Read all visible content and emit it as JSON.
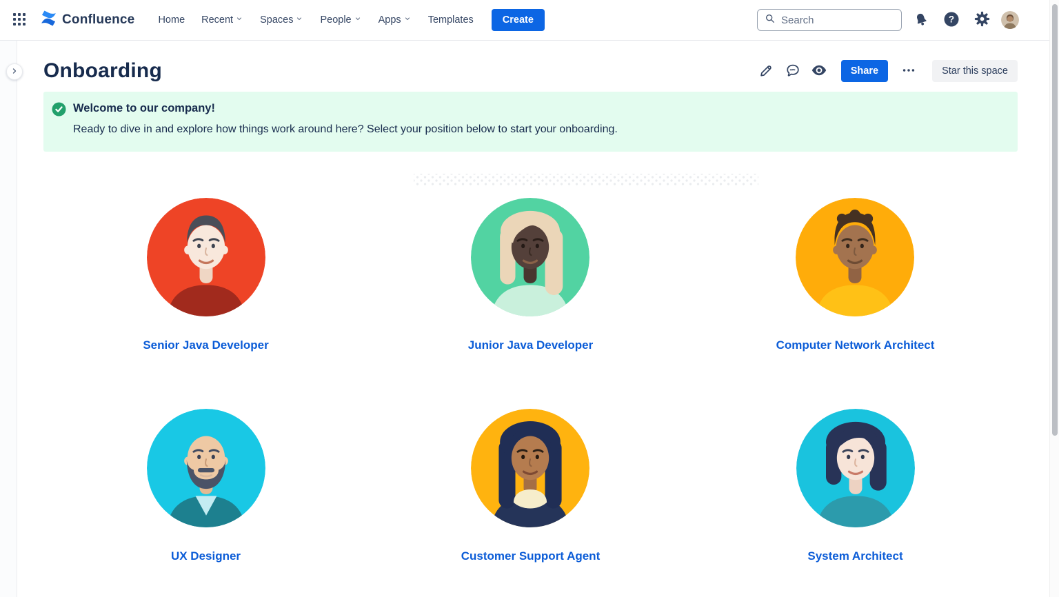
{
  "topbar": {
    "product_name": "Confluence",
    "nav_items": [
      {
        "label": "Home",
        "dropdown": false
      },
      {
        "label": "Recent",
        "dropdown": true
      },
      {
        "label": "Spaces",
        "dropdown": true
      },
      {
        "label": "People",
        "dropdown": true
      },
      {
        "label": "Apps",
        "dropdown": true
      },
      {
        "label": "Templates",
        "dropdown": false
      }
    ],
    "create_button": "Create",
    "search_placeholder": "Search"
  },
  "page_header": {
    "title": "Onboarding",
    "share_button": "Share",
    "star_button": "Star this space"
  },
  "banner": {
    "heading": "Welcome to our company!",
    "message": "Ready to dive in and explore how things work around here? Select your position below to start your onboarding."
  },
  "roles": [
    {
      "label": "Senior Java Developer",
      "avatar": {
        "variant": "buzz",
        "colors": {
          "bg": "#EE4426",
          "skin": "#F8E8DC",
          "skinD": "#EFD6C4",
          "hair": "#4A4E58",
          "shirt": "#A12A1D",
          "brow": "#3E4450",
          "eye": "#3E4450",
          "mouth": "#C4765B",
          "nose": "#D9B59F"
        }
      }
    },
    {
      "label": "Junior Java Developer",
      "avatar": {
        "variant": "long",
        "colors": {
          "bg": "#52D3A2",
          "skin": "#54403A",
          "skinD": "#48362F",
          "hair": "#EBD6B8",
          "shirt": "#C9F0DC",
          "brow": "#2A1E19",
          "eye": "#241A16",
          "mouth": "#8A6248",
          "nose": "#3A2B24"
        }
      }
    },
    {
      "label": "Computer Network Architect",
      "avatar": {
        "variant": "curly",
        "colors": {
          "bg": "#FFAC0A",
          "skin": "#A3734F",
          "skinD": "#916344",
          "hair": "#453122",
          "shirt": "#FFC116",
          "brow": "#3F2D1F",
          "eye": "#32241A",
          "mouth": "#6E4C34",
          "nose": "#7E5A3F"
        }
      }
    },
    {
      "label": "UX Designer",
      "avatar": {
        "variant": "beard",
        "colors": {
          "bg": "#19C8E5",
          "skin": "#EEC9A4",
          "skinD": "#E2BA92",
          "hair": "#4A5367",
          "shirt": "#1D808F",
          "inner": "#C3ECF2",
          "brow": "#444D61",
          "eye": "#3A4154",
          "mouth": "#D9B9A0",
          "nose": "#C89B77"
        }
      }
    },
    {
      "label": "Customer Support Agent",
      "avatar": {
        "variant": "collar",
        "colors": {
          "bg": "#FFB30F",
          "skin": "#B57C4F",
          "skinD": "#A56F45",
          "hair": "#202E55",
          "shirt": "#253459",
          "collar": "#F6EDCB",
          "brow": "#2E2117",
          "eye": "#25190F",
          "mouth": "#7E4A33",
          "nose": "#8F6040"
        }
      }
    },
    {
      "label": "System Architect",
      "avatar": {
        "variant": "bob",
        "colors": {
          "bg": "#1AC3DE",
          "skin": "#F7E4D8",
          "skinD": "#EDD2C2",
          "hair": "#283357",
          "shirt": "#2C9BAC",
          "brow": "#3C455B",
          "eye": "#333B50",
          "mouth": "#C97B68",
          "nose": "#DCB49E"
        }
      }
    }
  ],
  "colors": {
    "accent_blue": "#0C66E4",
    "link_blue": "#0B5CD7",
    "nav_text": "#344563",
    "title_text": "#172B4D",
    "banner_bg": "#E3FCEF",
    "success_green": "#22A06B"
  }
}
